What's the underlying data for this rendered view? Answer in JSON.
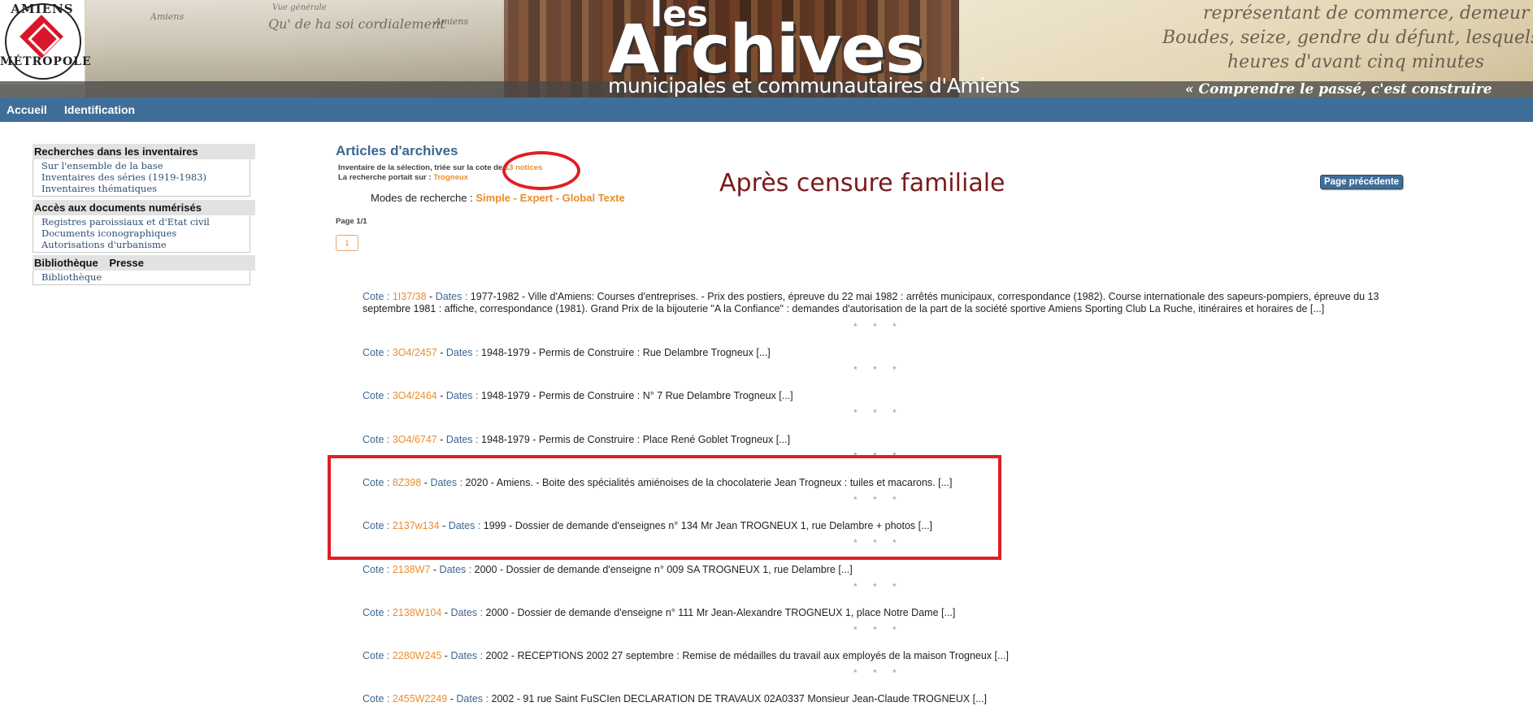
{
  "logo": {
    "top": "AMIENS",
    "bottom": "MÉTROPOLE"
  },
  "banner": {
    "les": "les",
    "archives": "Archives",
    "subtitle": "municipales et communautaires d'Amiens",
    "motto": "« Comprendre le passé, c'est construire notre avenir »",
    "postcard_texts": [
      "Amiens",
      "Vue générale",
      "Qu' de ha soi cordialement",
      "Amiens"
    ],
    "letter_texts": [
      "représentant de commerce, demeur",
      "Boudes, seize, gendre du défunt, lesquels",
      "heures d'avant cinq minutes"
    ]
  },
  "nav": {
    "items": [
      "Accueil",
      "Identification"
    ]
  },
  "sidebar": {
    "sections": [
      {
        "title": "Recherches dans les inventaires",
        "links": [
          "Sur l'ensemble de la base",
          "Inventaires des séries (1919-1983)",
          "Inventaires thématiques"
        ]
      },
      {
        "title": "Accès aux documents numérisés",
        "links": [
          "Registres paroissiaux et d'Etat civil",
          "Documents iconographiques",
          "Autorisations d'urbanisme"
        ]
      },
      {
        "title_parts": [
          "Bibliothèque",
          "Presse"
        ],
        "links": [
          "Bibliothèque"
        ]
      }
    ]
  },
  "main": {
    "title": "Articles d'archives",
    "inventory_text": "Inventaire de la sélection, triée sur la cote de",
    "notice_count": "13 notices",
    "search_text": "La recherche portait sur :",
    "search_term": "Trogneux",
    "censure_note": "Après censure familiale",
    "prev_button": "Page précédente",
    "modes_label": "Modes de recherche :",
    "modes": [
      "Simple",
      "Expert",
      "Global Texte"
    ],
    "page_info": "Page 1/1",
    "page_button": "1",
    "cote_label": "Cote :",
    "dates_label": "Dates :",
    "stars": "* * *",
    "records": [
      {
        "cote": "1I37/38",
        "text": "1977-1982 - Ville d'Amiens: Courses d'entreprises. - Prix des postiers, épreuve du 22 mai 1982 : arrêtés municipaux, correspondance (1982). Course internationale des sapeurs-pompiers, épreuve du 13 septembre 1981 : affiche, correspondance (1981). Grand Prix de la bijouterie \"A la Confiance\" : demandes d'autorisation de la part de la société sportive Amiens Sporting Club La Ruche, itinéraires et horaires de [...]"
      },
      {
        "cote": "3O4/2457",
        "text": "1948-1979 - Permis de Construire : Rue Delambre Trogneux [...]"
      },
      {
        "cote": "3O4/2464",
        "text": "1948-1979 - Permis de Construire : N° 7 Rue Delambre Trogneux [...]"
      },
      {
        "cote": "3O4/6747",
        "text": "1948-1979 - Permis de Construire : Place René Goblet Trogneux [...]"
      },
      {
        "cote": "8Z398",
        "text": "2020 - Amiens. - Boite des spécialités amiénoises de la chocolaterie Jean Trogneux : tuiles et macarons. [...]"
      },
      {
        "cote": "2137w134",
        "text": "1999 - Dossier de demande d'enseignes n° 134 Mr Jean TROGNEUX 1, rue Delambre + photos [...]"
      },
      {
        "cote": "2138W7",
        "text": "2000 - Dossier de demande d'enseigne n° 009 SA TROGNEUX 1, rue Delambre [...]"
      },
      {
        "cote": "2138W104",
        "text": "2000 - Dossier de demande d'enseigne n° 111 Mr Jean-Alexandre TROGNEUX 1, place Notre Dame [...]"
      },
      {
        "cote": "2280W245",
        "text": "2002 - RECEPTIONS 2002 27 septembre : Remise de médailles du travail aux employés de la maison Trogneux [...]"
      },
      {
        "cote": "2455W2249",
        "text": "2002 - 91 rue Saint FuSCIen DECLARATION DE TRAVAUX 02A0337 Monsieur Jean-Claude TROGNEUX [...]"
      }
    ]
  },
  "colors": {
    "nav": "#3f6e98",
    "link": "#3c6791",
    "accent": "#e88e2d",
    "annotation": "#e01e24",
    "censure": "#7a1a1a"
  }
}
